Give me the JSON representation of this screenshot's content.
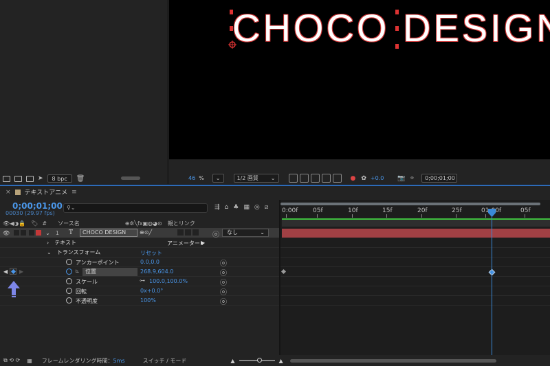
{
  "project_panel": {
    "bpc_label": "8 bpc"
  },
  "viewer": {
    "comp_text": "CHOCO DESIGN",
    "zoom_value": "46",
    "zoom_unit": "%",
    "resolution": "1/2 画質",
    "exposure": "+0.0",
    "timecode": "0;00;01;00"
  },
  "timeline": {
    "tab_title": "テキストアニメ",
    "current_time": "0;00;01;00",
    "fps_info": "00030 (29.97 fps)",
    "columns": {
      "source_name": "ソース名",
      "parent_link": "親とリンク"
    },
    "layer": {
      "number": "1",
      "type_icon": "T",
      "name": "CHOCO DESIGN",
      "parent": "なし"
    },
    "text_group": {
      "label": "テキスト",
      "animator_label": "アニメーター :"
    },
    "transform_group": {
      "label": "トランスフォーム",
      "reset_label": "リセット"
    },
    "properties": [
      {
        "name": "アンカーポイント",
        "value": "0.0,0.0"
      },
      {
        "name": "位置",
        "value": "268.9,604.0"
      },
      {
        "name": "スケール",
        "value": "100.0,100.0%"
      },
      {
        "name": "回転",
        "value": "0x+0.0°"
      },
      {
        "name": "不透明度",
        "value": "100%"
      }
    ],
    "ruler_labels": [
      "0:00f",
      "05f",
      "10f",
      "15f",
      "20f",
      "25f",
      "01:00f",
      "05f"
    ],
    "status": {
      "render_time_label": "フレームレンダリング時間：",
      "render_time_value": "5ms",
      "switch_mode": "スイッチ / モード"
    }
  },
  "colors": {
    "accent_blue": "#4a96e8",
    "layer_bar": "#a14044",
    "comp_text_stroke": "#cc3333"
  }
}
